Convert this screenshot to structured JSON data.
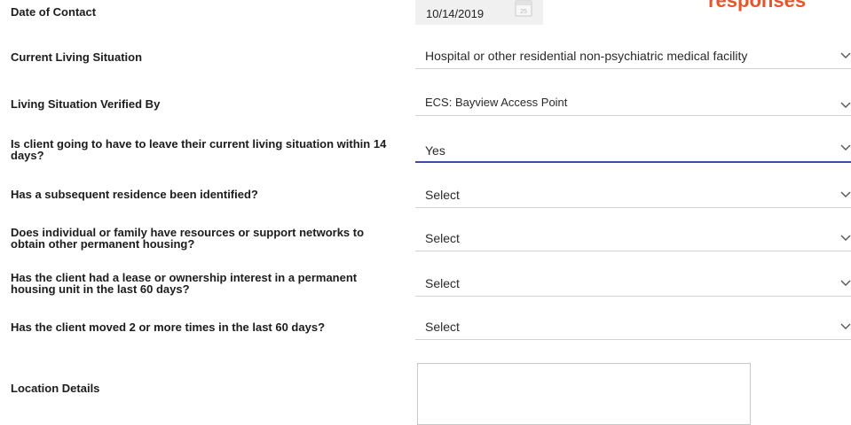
{
  "annotation": "responses",
  "date_of_contact": {
    "label": "Date of Contact",
    "value": "10/14/2019",
    "icon": "calendar-icon",
    "icon_number": "25"
  },
  "fields": [
    {
      "label": "Current Living Situation",
      "value": "Hospital or other residential non-psychiatric medical facility"
    },
    {
      "label": "Living Situation Verified By",
      "value": "ECS: Bayview Access Point"
    },
    {
      "label": "Is client going to have to leave their current living situation within 14 days?",
      "value": "Yes"
    },
    {
      "label": "Has a subsequent residence been identified?",
      "value": "Select"
    },
    {
      "label": "Does individual or family have resources or support networks to obtain other permanent housing?",
      "value": "Select"
    },
    {
      "label": "Has the client had a lease or ownership interest in a permanent housing unit in the last 60 days?",
      "value": "Select"
    },
    {
      "label": "Has the client moved 2 or more times in the last 60 days?",
      "value": "Select"
    }
  ],
  "location_details": {
    "label": "Location Details",
    "value": ""
  },
  "colors": {
    "annotation": "#e8542a",
    "active_underline": "#3a4f9a"
  }
}
